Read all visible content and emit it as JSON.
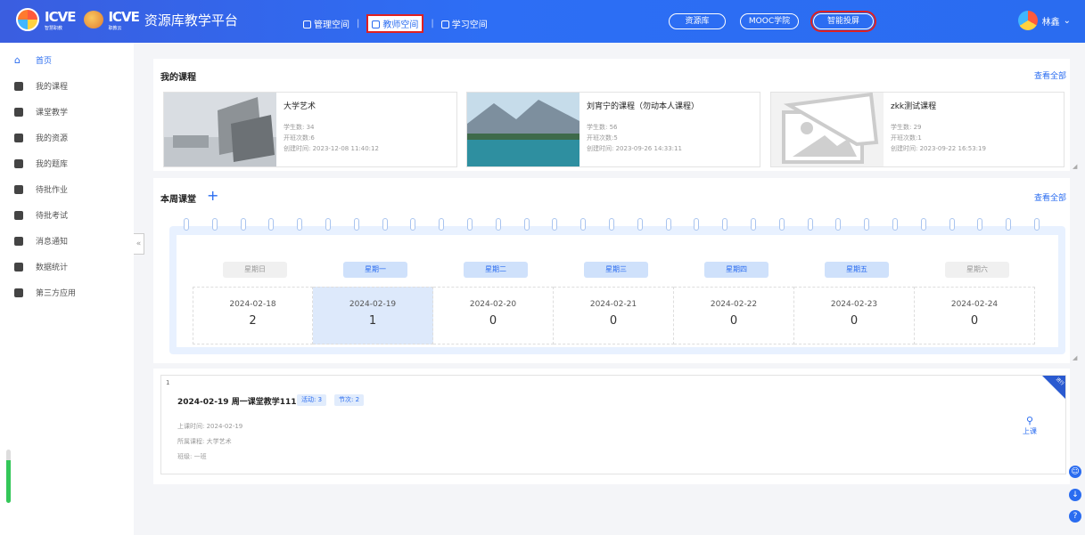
{
  "brand": {
    "logo1": "ICVE",
    "logo1_sub": "智慧职教",
    "logo2": "ICVE",
    "logo2_sub": "职教云",
    "platform": "资源库教学平台"
  },
  "nav": {
    "manage": "管理空间",
    "teacher": "教师空间",
    "study": "学习空间"
  },
  "pills": {
    "resource": "资源库",
    "mooc": "MOOC学院",
    "smart": "智能投屏"
  },
  "user": {
    "name": "林鑫",
    "caret": "⌄"
  },
  "sidebar": {
    "items": [
      {
        "label": "首页",
        "icon": "home-icon"
      },
      {
        "label": "我的课程",
        "icon": "course-icon"
      },
      {
        "label": "课堂教学",
        "icon": "play-icon"
      },
      {
        "label": "我的资源",
        "icon": "resource-icon"
      },
      {
        "label": "我的题库",
        "icon": "question-bank-icon"
      },
      {
        "label": "待批作业",
        "icon": "homework-icon"
      },
      {
        "label": "待批考试",
        "icon": "exam-icon"
      },
      {
        "label": "消息通知",
        "icon": "message-icon"
      },
      {
        "label": "数据统计",
        "icon": "stats-icon"
      },
      {
        "label": "第三方应用",
        "icon": "apps-icon"
      }
    ]
  },
  "courses": {
    "title": "我的课程",
    "more": "查看全部",
    "items": [
      {
        "name": "大学艺术",
        "students": "学生数: 34",
        "classes": "开班次数:6",
        "created": "创建时间: 2023-12-08 11:40:12"
      },
      {
        "name": "刘宵宁的课程（勿动本人课程）",
        "students": "学生数: 56",
        "classes": "开班次数:5",
        "created": "创建时间: 2023-09-26 14:33:11"
      },
      {
        "name": "zkk测试课程",
        "students": "学生数: 29",
        "classes": "开班次数:1",
        "created": "创建时间: 2023-09-22 16:53:19"
      }
    ]
  },
  "week": {
    "title": "本周课堂",
    "plus": "+",
    "more": "查看全部",
    "days": [
      {
        "name": "星期日",
        "date": "2024-02-18",
        "count": "2",
        "state": "off"
      },
      {
        "name": "星期一",
        "date": "2024-02-19",
        "count": "1",
        "state": "on"
      },
      {
        "name": "星期二",
        "date": "2024-02-20",
        "count": "0",
        "state": "on"
      },
      {
        "name": "星期三",
        "date": "2024-02-21",
        "count": "0",
        "state": "on"
      },
      {
        "name": "星期四",
        "date": "2024-02-22",
        "count": "0",
        "state": "on"
      },
      {
        "name": "星期五",
        "date": "2024-02-23",
        "count": "0",
        "state": "on"
      },
      {
        "name": "星期六",
        "date": "2024-02-24",
        "count": "0",
        "state": "off"
      }
    ],
    "selected": "2024-02-19"
  },
  "lesson": {
    "index": "1",
    "title": "2024-02-19 周一课堂教学1111",
    "tag_activity": "活动: 3",
    "tag_period": "节次: 2",
    "time": "上课时间: 2024-02-19",
    "course": "所属课程: 大学艺术",
    "class": "班级: 一班",
    "corner": "进行",
    "start": "上课"
  },
  "colors": {
    "primary": "#2a6cf0",
    "highlight": "#e02020"
  }
}
